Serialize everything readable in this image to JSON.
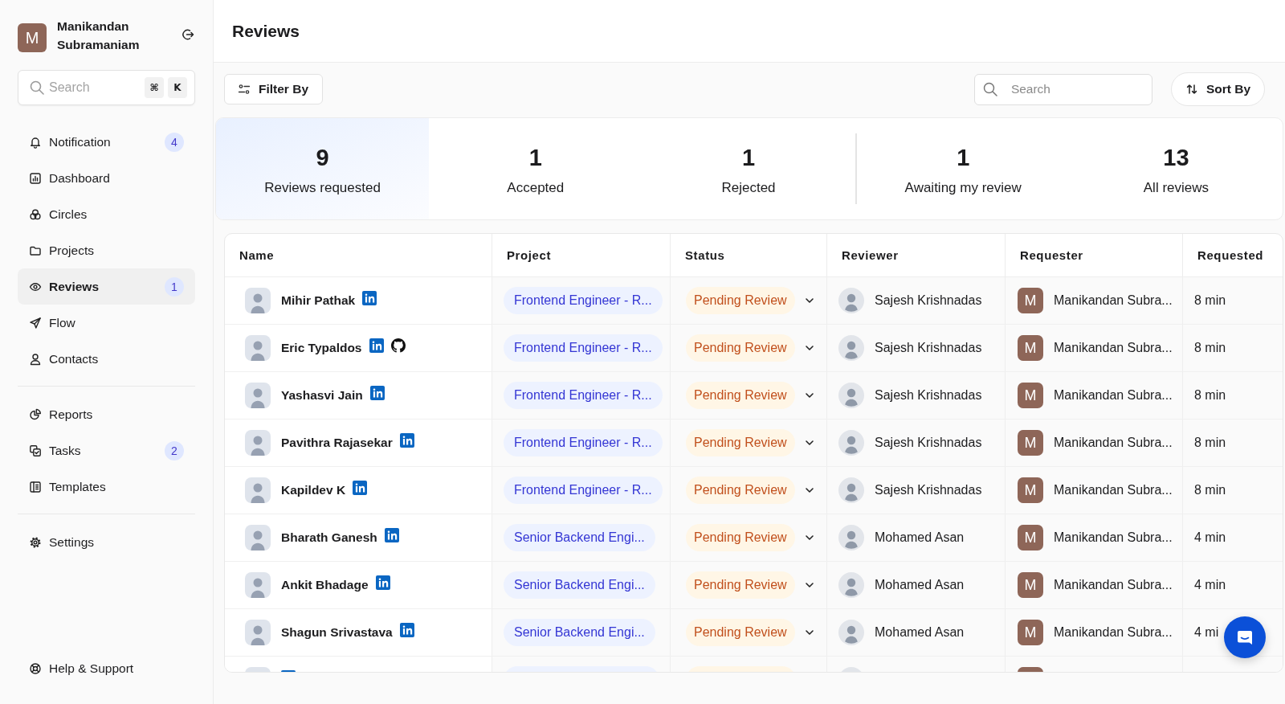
{
  "sidebar": {
    "profile": {
      "initial": "M",
      "name": "Manikandan Subramaniam"
    },
    "search": {
      "placeholder": "Search",
      "shortcut": [
        "⌘",
        "K"
      ]
    },
    "nav_groups": [
      {
        "items": [
          {
            "label": "Notification",
            "badge": "4",
            "selected": false
          },
          {
            "label": "Dashboard",
            "selected": false
          },
          {
            "label": "Circles",
            "selected": false
          },
          {
            "label": "Projects",
            "selected": false
          },
          {
            "label": "Reviews",
            "badge": "1",
            "selected": true
          },
          {
            "label": "Flow",
            "selected": false
          },
          {
            "label": "Contacts",
            "selected": false
          }
        ]
      },
      {
        "items": [
          {
            "label": "Reports",
            "selected": false
          },
          {
            "label": "Tasks",
            "badge": "2",
            "selected": false
          },
          {
            "label": "Templates",
            "selected": false
          }
        ]
      },
      {
        "items": [
          {
            "label": "Settings",
            "selected": false
          }
        ]
      }
    ],
    "footer_items": [
      {
        "label": "Help & Support",
        "selected": false
      }
    ]
  },
  "header": {
    "title": "Reviews"
  },
  "toolbar": {
    "filter_button": "Filter By",
    "search": {
      "placeholder": "Search"
    },
    "sort_button": "Sort By"
  },
  "stats": {
    "groups": [
      {
        "items": [
          {
            "value": "9",
            "label": "Reviews requested",
            "selected": true
          },
          {
            "value": "1",
            "label": "Accepted",
            "selected": false
          },
          {
            "value": "1",
            "label": "Rejected",
            "selected": false
          }
        ]
      },
      {
        "items": [
          {
            "value": "1",
            "label": "Awaiting my review",
            "selected": false
          },
          {
            "value": "13",
            "label": "All reviews",
            "selected": false
          }
        ]
      }
    ]
  },
  "table": {
    "columns": [
      "Name",
      "Project",
      "Status",
      "Reviewer",
      "Requester",
      "Requested"
    ],
    "rows": [
      {
        "name": "Mihir Pathak",
        "linkedin": true,
        "github": false,
        "project": "Frontend Engineer - R...",
        "status": "Pending Review",
        "reviewer": "Sajesh Krishnadas",
        "requester_initial": "M",
        "requester": "Manikandan Subra...",
        "requested": "8 min"
      },
      {
        "name": "Eric Typaldos",
        "linkedin": true,
        "github": true,
        "project": "Frontend Engineer - R...",
        "status": "Pending Review",
        "reviewer": "Sajesh Krishnadas",
        "requester_initial": "M",
        "requester": "Manikandan Subra...",
        "requested": "8 min"
      },
      {
        "name": "Yashasvi Jain",
        "linkedin": true,
        "github": false,
        "project": "Frontend Engineer - R...",
        "status": "Pending Review",
        "reviewer": "Sajesh Krishnadas",
        "requester_initial": "M",
        "requester": "Manikandan Subra...",
        "requested": "8 min"
      },
      {
        "name": "Pavithra Rajasekar",
        "linkedin": true,
        "github": false,
        "project": "Frontend Engineer - R...",
        "status": "Pending Review",
        "reviewer": "Sajesh Krishnadas",
        "requester_initial": "M",
        "requester": "Manikandan Subra...",
        "requested": "8 min"
      },
      {
        "name": "Kapildev K",
        "linkedin": true,
        "github": false,
        "project": "Frontend Engineer - R...",
        "status": "Pending Review",
        "reviewer": "Sajesh Krishnadas",
        "requester_initial": "M",
        "requester": "Manikandan Subra...",
        "requested": "8 min"
      },
      {
        "name": "Bharath Ganesh",
        "linkedin": true,
        "github": false,
        "project": "Senior Backend Engi...",
        "status": "Pending Review",
        "reviewer": "Mohamed Asan",
        "requester_initial": "M",
        "requester": "Manikandan Subra...",
        "requested": "4 min"
      },
      {
        "name": "Ankit Bhadage",
        "linkedin": true,
        "github": false,
        "project": "Senior Backend Engi...",
        "status": "Pending Review",
        "reviewer": "Mohamed Asan",
        "requester_initial": "M",
        "requester": "Manikandan Subra...",
        "requested": "4 min"
      },
      {
        "name": "Shagun Srivastava",
        "linkedin": true,
        "github": false,
        "project": "Senior Backend Engi...",
        "status": "Pending Review",
        "reviewer": "Mohamed Asan",
        "requester_initial": "M",
        "requester": "Manikandan Subra...",
        "requested": "4 mi"
      },
      {
        "linkedin": true,
        "github": false
      }
    ]
  }
}
